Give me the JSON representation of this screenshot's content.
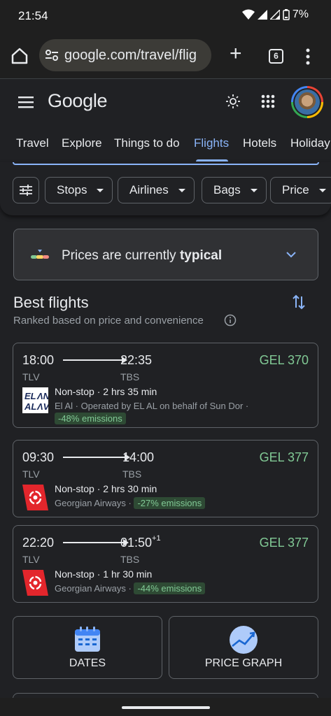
{
  "status_bar": {
    "time": "21:54",
    "battery": "7%"
  },
  "browser": {
    "url": "google.com/travel/flig",
    "tab_count": "6"
  },
  "header": {
    "logo": "Google"
  },
  "nav_tabs": [
    {
      "label": "Travel"
    },
    {
      "label": "Explore"
    },
    {
      "label": "Things to do"
    },
    {
      "label": "Flights",
      "active": true
    },
    {
      "label": "Hotels"
    },
    {
      "label": "Holiday"
    }
  ],
  "filters": [
    {
      "label": "Stops"
    },
    {
      "label": "Airlines"
    },
    {
      "label": "Bags"
    },
    {
      "label": "Price"
    }
  ],
  "price_banner": {
    "prefix": "Prices are currently ",
    "status": "typical"
  },
  "best": {
    "title": "Best flights",
    "subtitle": "Ranked based on price and convenience"
  },
  "flights": [
    {
      "depart": "18:00",
      "arrive": "22:35",
      "arrive_offset": "",
      "from": "TLV",
      "to": "TBS",
      "price": "GEL 370",
      "stops": "Non-stop",
      "duration": "2 hrs 35 min",
      "airline": "El Al · Operated by EL AL on behalf of Sun Dor ·",
      "emissions": "-48% emissions",
      "logo_text": "EL AL"
    },
    {
      "depart": "09:30",
      "arrive": "14:00",
      "arrive_offset": "",
      "from": "TLV",
      "to": "TBS",
      "price": "GEL 377",
      "stops": "Non-stop",
      "duration": "2 hrs 30 min",
      "airline": "Georgian Airways ·",
      "emissions": "-27% emissions"
    },
    {
      "depart": "22:20",
      "arrive": "01:50",
      "arrive_offset": "+1",
      "from": "TLV",
      "to": "TBS",
      "price": "GEL 377",
      "stops": "Non-stop",
      "duration": "1 hr 30 min",
      "airline": "Georgian Airways ·",
      "emissions": "-44% emissions"
    }
  ],
  "bottom_buttons": {
    "dates": "DATES",
    "price_graph": "PRICE GRAPH"
  },
  "colors": {
    "accent": "#8ab4f8",
    "price_green": "#81c995",
    "bg": "#202124",
    "georgian_red": "#e3262c"
  }
}
